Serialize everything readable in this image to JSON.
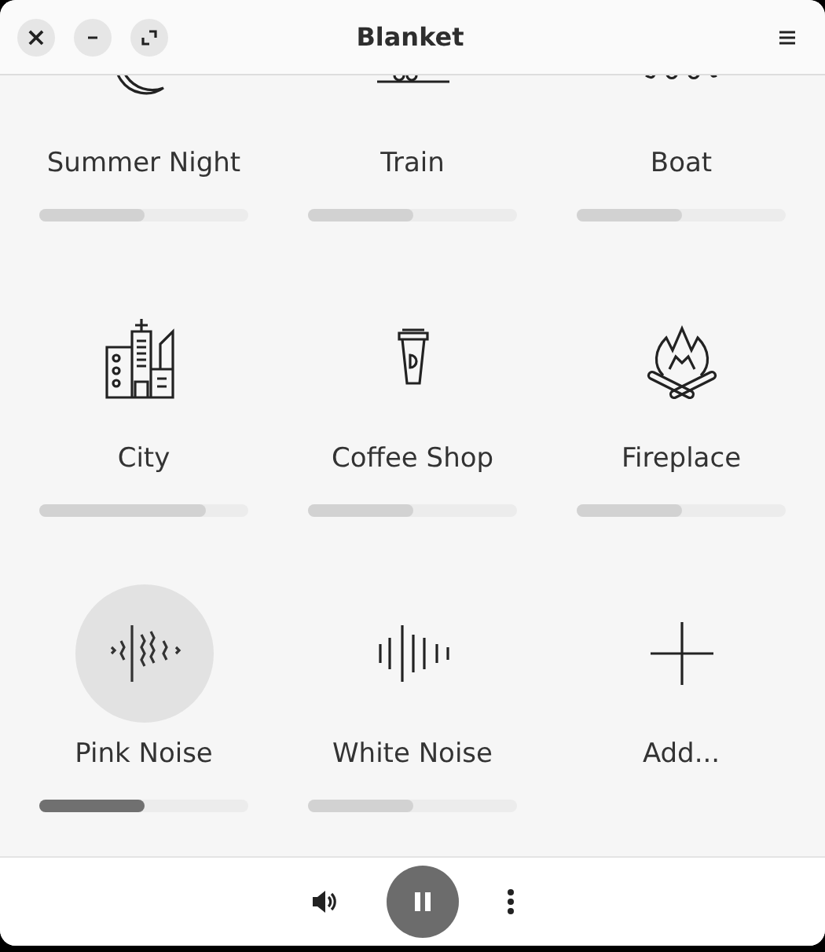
{
  "window": {
    "title": "Blanket",
    "close": "×"
  },
  "sounds": [
    {
      "kind": "sound",
      "name": "Summer Night",
      "level": 0.5,
      "selected": false
    },
    {
      "kind": "sound",
      "name": "Train",
      "level": 0.5,
      "selected": false
    },
    {
      "kind": "sound",
      "name": "Boat",
      "level": 0.5,
      "selected": false
    },
    {
      "kind": "sound",
      "name": "City",
      "level": 0.8,
      "selected": false
    },
    {
      "kind": "sound",
      "name": "Coffee Shop",
      "level": 0.5,
      "selected": false
    },
    {
      "kind": "sound",
      "name": "Fireplace",
      "level": 0.5,
      "selected": false
    },
    {
      "kind": "sound",
      "name": "Pink Noise",
      "level": 0.5,
      "selected": true
    },
    {
      "kind": "sound",
      "name": "White Noise",
      "level": 0.5,
      "selected": false
    },
    {
      "kind": "add",
      "name": "Add..."
    }
  ]
}
